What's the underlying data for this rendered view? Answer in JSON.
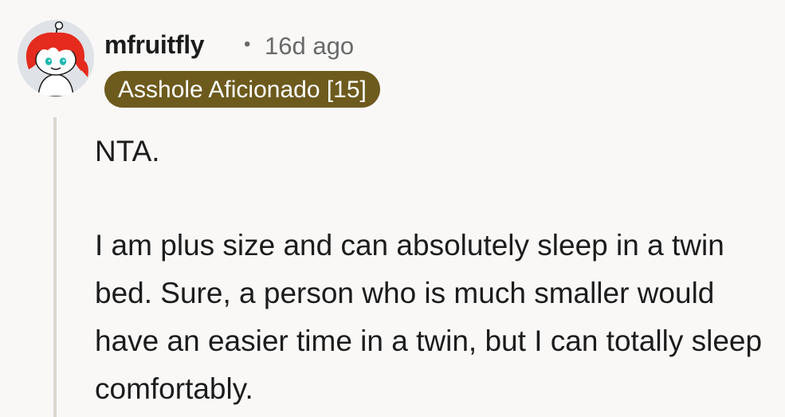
{
  "comment": {
    "avatar_icon": "snoo-avatar-icon",
    "username": "mfruitfly",
    "separator": "•",
    "timestamp": "16d ago",
    "flair": {
      "text": "Asshole Aficionado [15]",
      "background": "#6d5a1d",
      "color": "#ffffff"
    },
    "paragraphs": [
      "NTA.",
      "I am plus size and can absolutely sleep in a twin bed. Sure, a person who is much smaller would have an easier time in a twin, but I can totally sleep comfortably."
    ]
  }
}
